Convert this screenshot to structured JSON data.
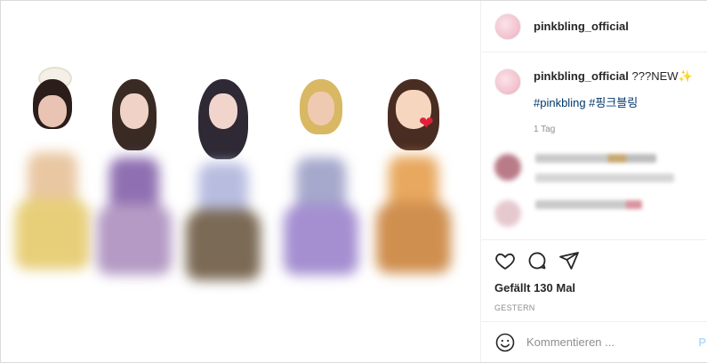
{
  "post": {
    "username": "pinkbling_official",
    "caption_text": "???NEW",
    "caption_emoji": "✨",
    "hashtags": "#pinkbling #핑크블링",
    "time_ago": "1 Tag",
    "likes": "Gefällt 130 Mal",
    "date": "GESTERN",
    "comment_placeholder": "Kommentieren ...",
    "post_button": "P"
  },
  "icons": {
    "like": "heart-icon",
    "comment": "comment-bubble-icon",
    "share": "paper-plane-icon",
    "emoji": "smiley-icon"
  },
  "colors": {
    "hashtag": "#00376b",
    "muted": "#8e8e8e",
    "border": "#dbdbdb",
    "post_button": "#b3dbff"
  }
}
